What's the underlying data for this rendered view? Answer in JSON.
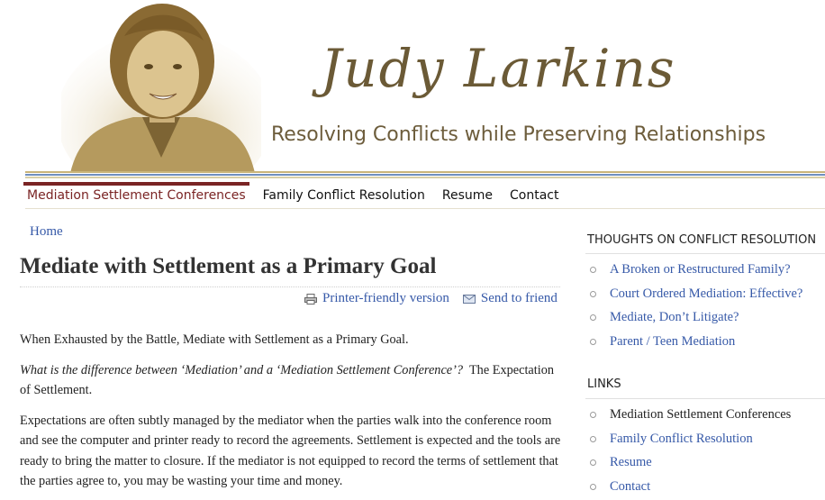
{
  "site": {
    "title": "Judy Larkins",
    "slogan": "Resolving Conflicts while Preserving Relationships"
  },
  "nav": {
    "items": [
      {
        "label": "Mediation Settlement Conferences",
        "active": true
      },
      {
        "label": "Family Conflict Resolution",
        "active": false
      },
      {
        "label": "Resume",
        "active": false
      },
      {
        "label": "Contact",
        "active": false
      }
    ]
  },
  "breadcrumb": "Home",
  "page_title": "Mediate with Settlement as a Primary Goal",
  "actions": {
    "printer_label": "Printer-friendly version",
    "printer_icon": "printer-icon",
    "send_label": "Send to friend",
    "send_icon": "envelope-icon"
  },
  "body": {
    "p1": "When Exhausted by the Battle, Mediate with Settlement as a Primary Goal.",
    "p2_italic": "What is the difference between ‘Mediation’ and a ‘Mediation Settlement Conference’?",
    "p2_rest": "The Expectation of Settlement.",
    "p3": "Expectations are often subtly managed by the mediator when the parties walk into the conference room and see the computer and printer ready to record the agreements.   Settlement is expected and the tools are ready to bring the matter to closure.  If the mediator is not equipped to record the terms of settlement that the parties agree to, you may be wasting your time and money."
  },
  "sidebar": {
    "thoughts_heading": "THOUGHTS ON CONFLICT RESOLUTION",
    "thoughts": [
      "A Broken or Restructured Family?",
      "Court Ordered Mediation: Effective?",
      "Mediate, Don’t Litigate?",
      "Parent / Teen Mediation"
    ],
    "links_heading": "LINKS",
    "links": [
      "Mediation Settlement Conferences",
      "Family Conflict Resolution",
      "Resume",
      "Contact"
    ]
  },
  "colors": {
    "title": "#6b5a36",
    "accent": "#7a2424",
    "link": "#3659a8",
    "line_tan": "#c9b57a",
    "line_blue": "#6f8fbf"
  }
}
